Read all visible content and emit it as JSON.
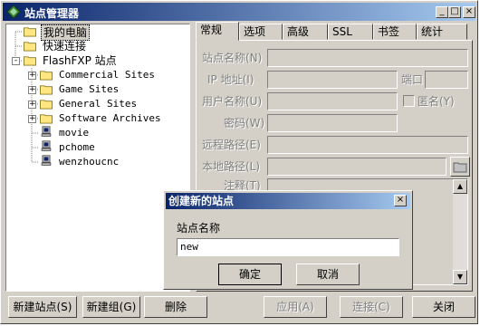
{
  "window": {
    "title": "站点管理器",
    "min": "_",
    "max": "□",
    "close": "×"
  },
  "tree": {
    "items": [
      {
        "label": "我的电脑",
        "icon": "computer-icon"
      },
      {
        "label": "快速连接",
        "icon": "folder-icon"
      },
      {
        "label": "FlashFXP 站点",
        "icon": "folder-icon",
        "expander": "-"
      },
      {
        "label": "Commercial Sites",
        "icon": "folder-icon",
        "expander": "+"
      },
      {
        "label": "Game Sites",
        "icon": "folder-icon",
        "expander": "+"
      },
      {
        "label": "General Sites",
        "icon": "folder-icon",
        "expander": "+"
      },
      {
        "label": "Software Archives",
        "icon": "folder-icon",
        "expander": "+"
      },
      {
        "label": "movie",
        "icon": "site-computer-icon"
      },
      {
        "label": "pchome",
        "icon": "site-computer-icon"
      },
      {
        "label": "wenzhoucnc",
        "icon": "site-computer-icon"
      }
    ]
  },
  "tabs": [
    "常规",
    "选项",
    "高级",
    "SSL",
    "书签",
    "统计"
  ],
  "form": {
    "site_name": "站点名称(N)",
    "ip": "IP 地址(I)",
    "port": "端口",
    "user": "用户名称(U)",
    "anon": "匿名(Y)",
    "password": "密码(W)",
    "remote_path": "远程路径(E)",
    "local_path": "本地路径(L)",
    "notes": "注释(T)"
  },
  "buttons": {
    "new_site": "新建站点(S)",
    "new_group": "新建组(G)",
    "delete": "删除",
    "apply": "应用(A)",
    "connect": "连接(C)",
    "close": "关闭"
  },
  "dialog": {
    "title": "创建新的站点",
    "close": "×",
    "label": "站点名称",
    "value": "new",
    "ok": "确定",
    "cancel": "取消"
  }
}
